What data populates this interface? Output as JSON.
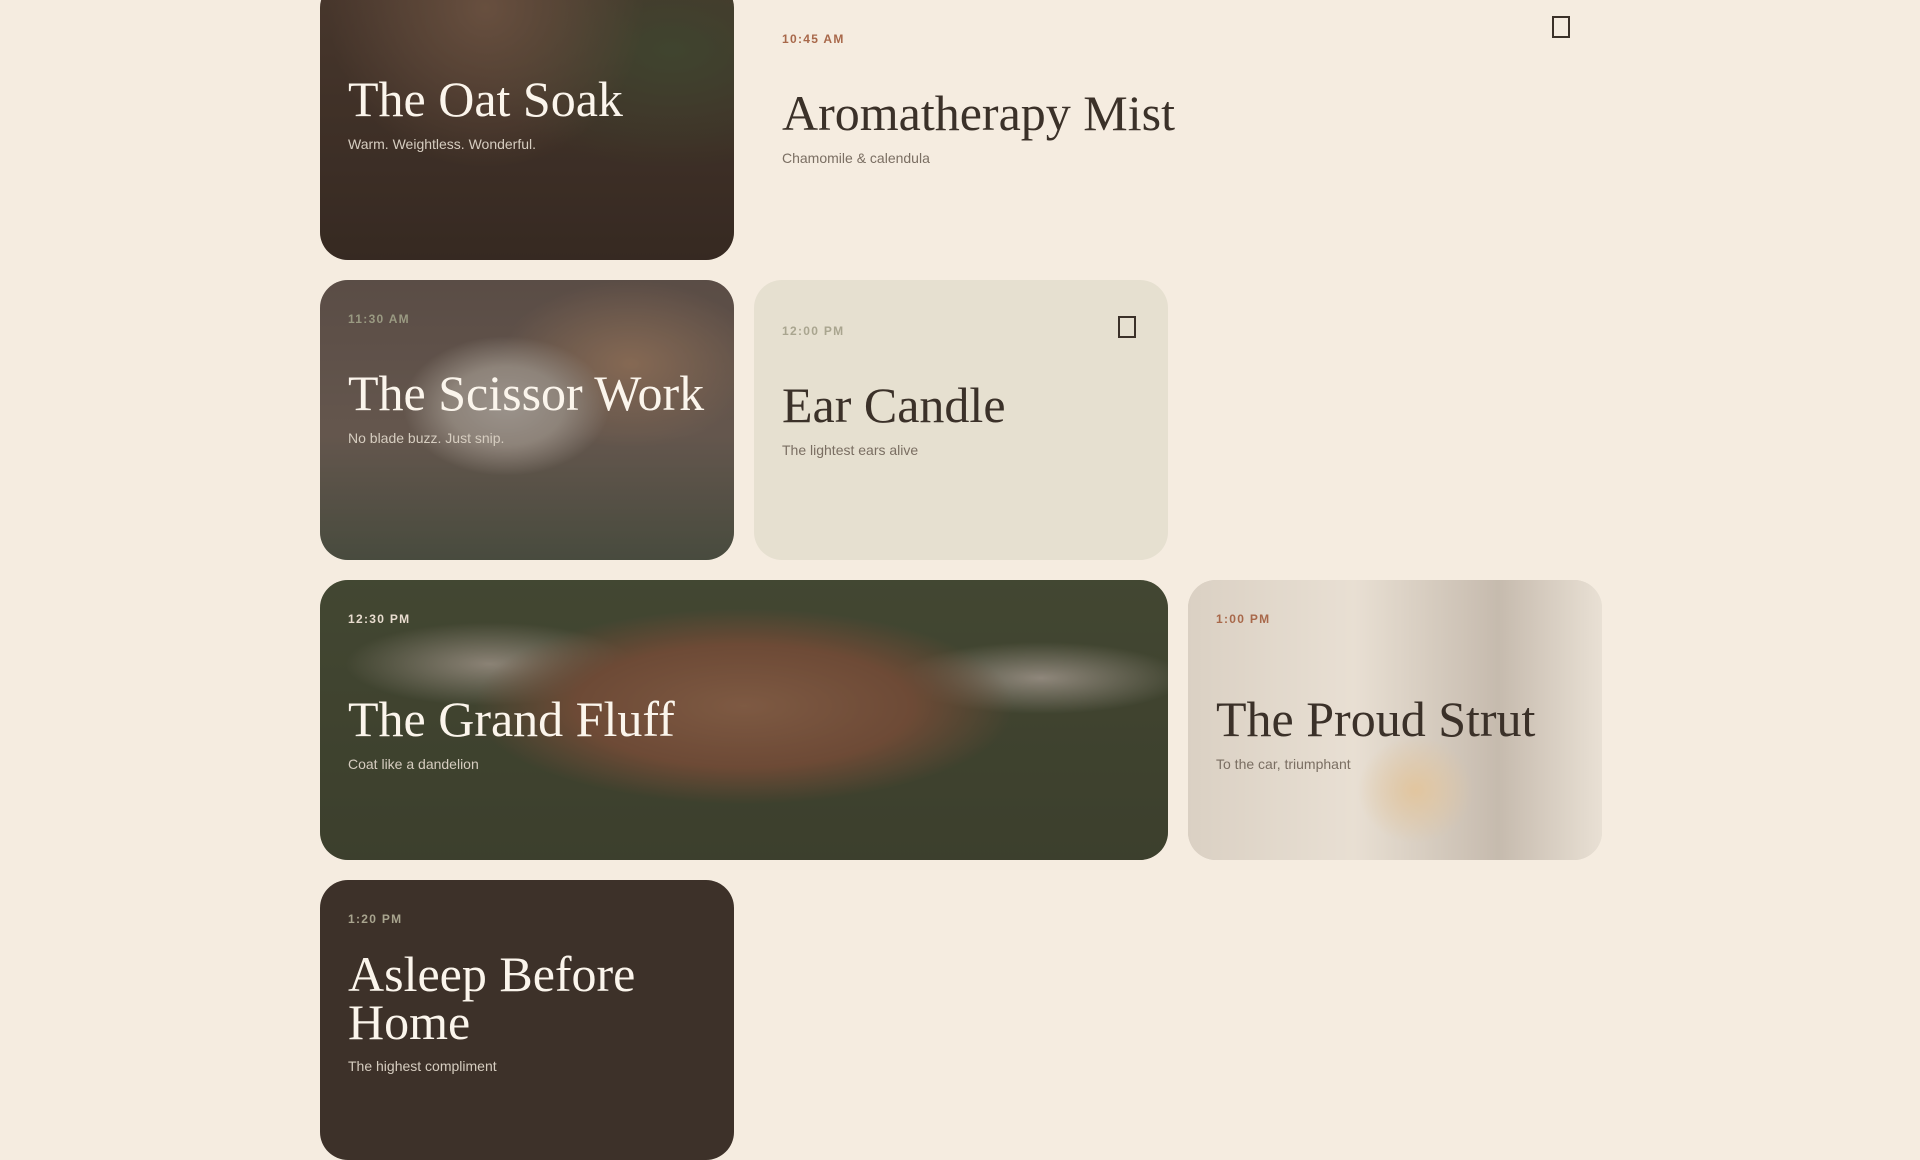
{
  "cards": [
    {
      "time": "",
      "title": "The Oat Soak",
      "subtitle": "Warm. Weightless. Wonderful."
    },
    {
      "time": "10:45 AM",
      "title": "Aromatherapy Mist",
      "subtitle": "Chamomile & calendula"
    },
    {
      "time": "11:30 AM",
      "title": "The Scissor Work",
      "subtitle": "No blade buzz. Just snip."
    },
    {
      "time": "12:00 PM",
      "title": "Ear Candle",
      "subtitle": "The lightest ears alive"
    },
    {
      "time": "12:30 PM",
      "title": "The Grand Fluff",
      "subtitle": "Coat like a dandelion"
    },
    {
      "time": "1:00 PM",
      "title": "The Proud Strut",
      "subtitle": "To the car, triumphant"
    },
    {
      "time": "1:20 PM",
      "title": "Asleep Before Home",
      "subtitle": "The highest compliment"
    }
  ],
  "colors": {
    "background": "#f5ece0",
    "time_accent": "#a8684a",
    "time_muted": "#9a9a82",
    "dark_text": "#3b3129"
  },
  "icons": {
    "bookmark": "bookmark-icon"
  }
}
